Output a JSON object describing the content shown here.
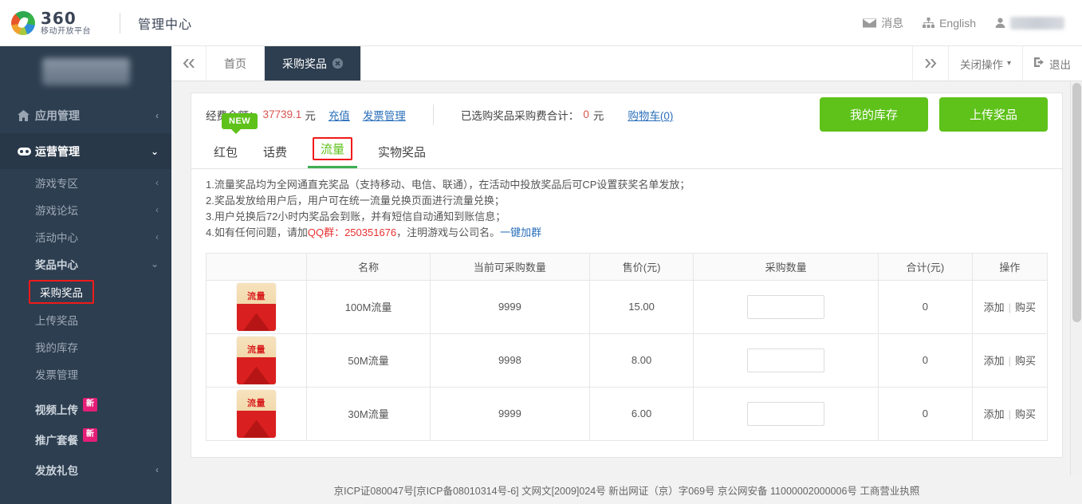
{
  "header": {
    "logo_number": "360",
    "logo_sub": "移动开放平台",
    "title": "管理中心",
    "message_label": "消息",
    "language_label": "English",
    "icons": {
      "envelope": "envelope-icon",
      "sitemap": "sitemap-icon",
      "user": "user-icon",
      "caret": "chevron-down-icon"
    }
  },
  "sidebar": {
    "items": [
      {
        "label": "应用管理",
        "icon": "home-icon",
        "chevron": "‹",
        "level": "top"
      },
      {
        "label": "运营管理",
        "icon": "gamepad-icon",
        "chevron": "⌄",
        "level": "top",
        "active": true
      }
    ],
    "sub_items": [
      {
        "label": "游戏专区",
        "chevron": "‹"
      },
      {
        "label": "游戏论坛",
        "chevron": "‹"
      },
      {
        "label": "活动中心",
        "chevron": "‹"
      },
      {
        "label": "奖品中心",
        "chevron": "⌄",
        "bold": true
      }
    ],
    "prize_children": [
      {
        "label": "采购奖品",
        "selected": true
      },
      {
        "label": "上传奖品"
      },
      {
        "label": "我的库存"
      },
      {
        "label": "发票管理"
      }
    ],
    "extra_items": [
      {
        "label": "视频上传",
        "badge": "新"
      },
      {
        "label": "推广套餐",
        "badge": "新"
      },
      {
        "label": "发放礼包",
        "chevron": "‹"
      }
    ]
  },
  "tabstrip": {
    "prev_icon": "chevron-double-left-icon",
    "next_icon": "chevron-double-right-icon",
    "tabs": [
      {
        "label": "首页",
        "active": false,
        "closable": false
      },
      {
        "label": "采购奖品",
        "active": true,
        "closable": true,
        "close_glyph": "✖"
      }
    ],
    "close_ops_label": "关闭操作",
    "close_ops_caret": "▾",
    "logout_label": "退出",
    "logout_icon": "logout-icon"
  },
  "balance_bar": {
    "balance_label": "经费余额：",
    "balance_amount": "37739.1",
    "unit": "元",
    "recharge_link": "充值",
    "invoice_link": "发票管理",
    "selected_label": "已选购奖品采购费合计：",
    "selected_amount": "0",
    "selected_unit": "元",
    "cart_link": "购物车(0)",
    "inventory_button": "我的库存",
    "upload_button": "上传奖品"
  },
  "product_tabs": {
    "new_badge": "NEW",
    "items": [
      {
        "label": "红包",
        "active": false
      },
      {
        "label": "话费",
        "active": false
      },
      {
        "label": "流量",
        "active": true
      },
      {
        "label": "实物奖品",
        "active": false
      }
    ]
  },
  "notes": {
    "line1": "1.流量奖品均为全网通直充奖品（支持移动、电信、联通），在活动中投放奖品后可CP设置获奖名单发放；",
    "line2": "2.奖品发放给用户后，用户可在统一流量兑换页面进行流量兑换；",
    "line3": "3.用户兑换后72小时内奖品会到账，并有短信自动通知到账信息；",
    "line4_pre": "4.如有任何问题，请加",
    "line4_qq": "QQ群：250351676",
    "line4_mid": "，注明游戏与公司名。",
    "line4_link": "一键加群"
  },
  "table": {
    "headers": [
      "",
      "名称",
      "当前可采购数量",
      "售价(元)",
      "采购数量",
      "合计(元)",
      "操作"
    ],
    "rows": [
      {
        "icon_text": "流量",
        "name": "100M流量",
        "stock": "9999",
        "price": "15.00",
        "qty_value": "",
        "qty_placeholder": "",
        "total": "0",
        "add_label": "添加",
        "buy_label": "购买"
      },
      {
        "icon_text": "流量",
        "name": "50M流量",
        "stock": "9998",
        "price": "8.00",
        "qty_value": "",
        "qty_placeholder": "",
        "total": "0",
        "add_label": "添加",
        "buy_label": "购买"
      },
      {
        "icon_text": "流量",
        "name": "30M流量",
        "stock": "9999",
        "price": "6.00",
        "qty_value": "",
        "qty_placeholder": "",
        "total": "0",
        "add_label": "添加",
        "buy_label": "购买"
      }
    ]
  },
  "footer": {
    "text": "京ICP证080047号[京ICP备08010314号-6] 文网文[2009]024号 新出网证（京）字069号 京公网安备 11000002000006号 工商营业执照"
  },
  "colors": {
    "sidebar_bg": "#2d3e50",
    "accent_green": "#5ec21a",
    "highlight_red": "#f11a1a",
    "link_blue": "#2a6fba",
    "amount_red": "#d9534f",
    "badge_pink": "#e51e77"
  }
}
